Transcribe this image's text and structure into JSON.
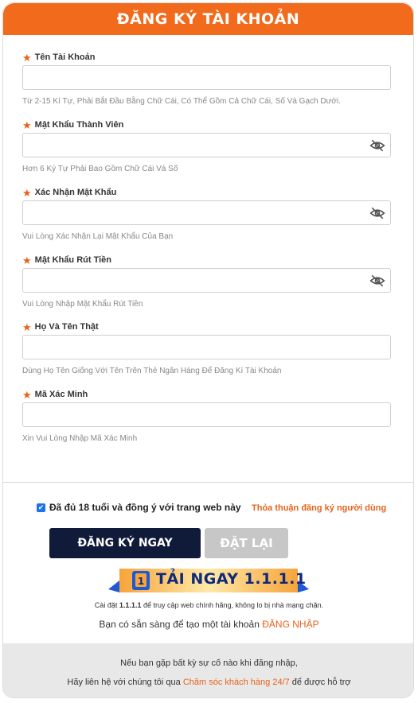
{
  "header": {
    "title": "ĐĂNG KÝ TÀI KHOẢN"
  },
  "fields": [
    {
      "label": "Tên Tài Khoản",
      "value": "",
      "hint": "Từ 2-15 Kí Tự, Phải Bắt Đầu Bằng Chữ Cái, Có Thể Gồm Cả Chữ Cái, Số Và Gạch Dưới.",
      "has_eye": false
    },
    {
      "label": "Mật Khẩu Thành Viên",
      "value": "",
      "hint": "Hơn 6 Ký Tự Phải Bao Gồm Chữ Cái Và Số",
      "has_eye": true
    },
    {
      "label": "Xác Nhận Mật Khẩu",
      "value": "",
      "hint": "Vui Lòng Xác Nhận Lại Mật Khẩu Của Bạn",
      "has_eye": true
    },
    {
      "label": "Mật Khẩu Rút Tiền",
      "value": "",
      "hint": "Vui Lòng Nhập Mật Khẩu Rút Tiền",
      "has_eye": true
    },
    {
      "label": "Họ Và Tên Thật",
      "value": "",
      "hint": "Dùng Họ Tên Giống Với Tên Trên Thẻ Ngân Hàng Để Đăng Kí Tài Khoản",
      "has_eye": false
    },
    {
      "label": "Mã Xác Minh",
      "value": "",
      "hint": "Xin Vui Lòng Nhập Mã Xác Minh",
      "has_eye": false
    }
  ],
  "agreement": {
    "checked": true,
    "text": "Đã đủ 18 tuổi và đồng ý với trang web này",
    "terms_link": "Thỏa thuận đăng ký người dùng"
  },
  "buttons": {
    "register": "ĐĂNG KÝ NGAY",
    "reset": "ĐẶT LẠI"
  },
  "banner": {
    "text": "TẢI NGAY 1.1.1.1",
    "logo_text": "1"
  },
  "install_note": {
    "prefix": "Cài đặt ",
    "bold": "1.1.1.1",
    "suffix": " để truy cập web chính hãng, không lo bị nhà mạng chặn."
  },
  "signin": {
    "text": "Bạn có sẵn sàng để tạo một tài khoản ",
    "link": "ĐĂNG NHẬP"
  },
  "footer": {
    "line1": "Nếu bạn gặp bất kỳ sự cố nào khi đăng nhập,",
    "line2_prefix": "Hãy liên hệ với chúng tôi qua ",
    "line2_link": "Chăm sóc khách hàng 24/7",
    "line2_suffix": " để được hỗ trợ"
  },
  "colors": {
    "accent": "#f26a1b",
    "primary_button": "#0f1b38",
    "reset_button": "#c7c7c7",
    "link": "#e8621a"
  }
}
